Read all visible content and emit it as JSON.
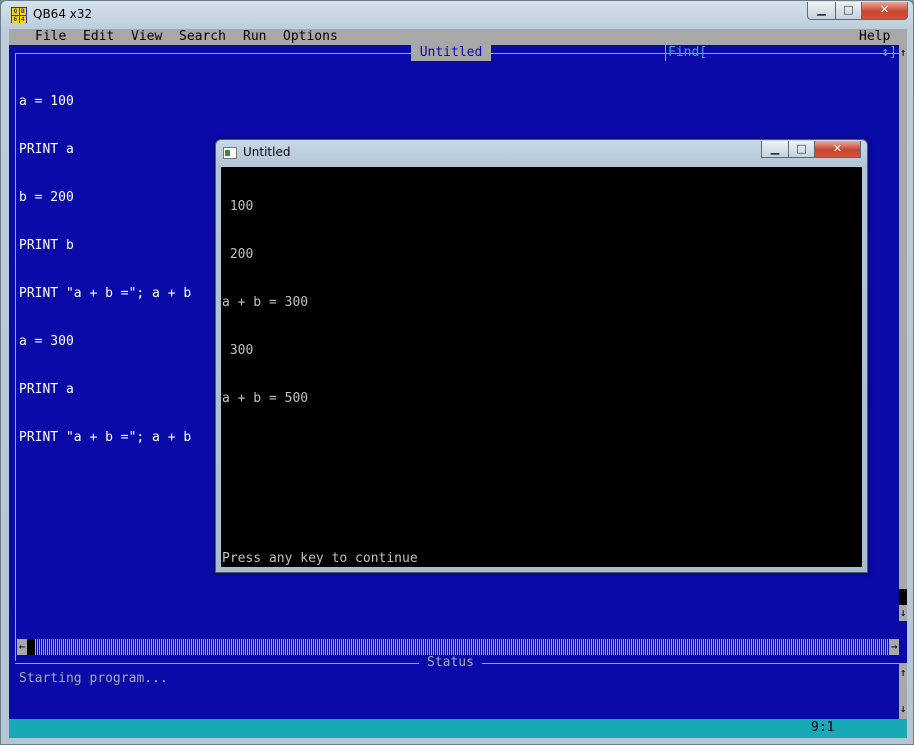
{
  "window": {
    "title": "QB64 x32",
    "icon_glyphs": [
      "Q",
      "B",
      "6",
      "4"
    ]
  },
  "menu": {
    "items": [
      "File",
      "Edit",
      "View",
      "Search",
      "Run",
      "Options"
    ],
    "help": "Help"
  },
  "editor": {
    "title": "Untitled",
    "find_label": "Find[",
    "find_arrows": "↕]",
    "code_lines": [
      "a = 100",
      "PRINT a",
      "b = 200",
      "PRINT b",
      "PRINT \"a + b =\"; a + b",
      "a = 300",
      "PRINT a",
      "PRINT \"a + b =\"; a + b"
    ]
  },
  "status": {
    "title": "Status",
    "text": "Starting program..."
  },
  "footer": {
    "cursor_position": "9:1"
  },
  "console": {
    "title": "Untitled",
    "output_lines": [
      " 100",
      " 200",
      "a + b = 300",
      " 300",
      "a + b = 500"
    ],
    "prompt": "Press any key to continue"
  },
  "glyphs": {
    "up": "↑",
    "down": "↓",
    "left": "←",
    "right": "→",
    "minimize": "▁",
    "maximize": "□",
    "close": "✕"
  },
  "colors": {
    "ide_background": "#0a0aa8",
    "menu_gray": "#a8a8a8",
    "footer_cyan": "#17a9b5",
    "find_text": "#3aa9e8"
  }
}
